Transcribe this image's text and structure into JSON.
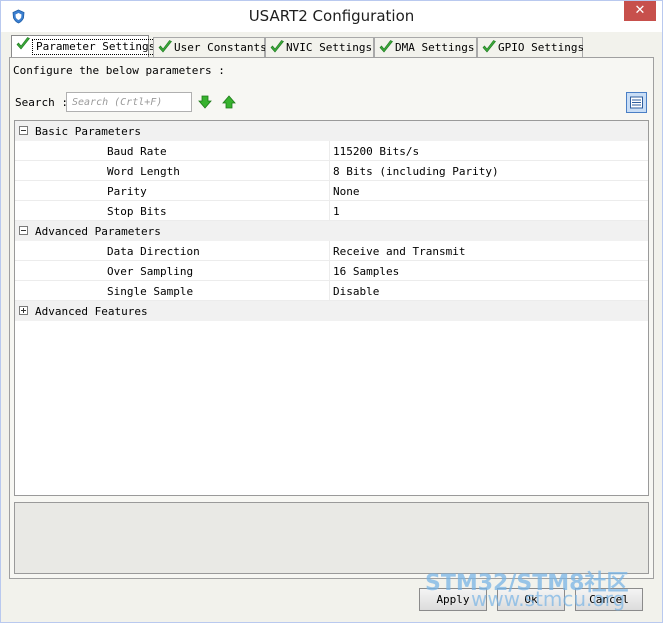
{
  "window": {
    "title": "USART2 Configuration",
    "close_glyph": "✕"
  },
  "tabs": [
    {
      "label": "Parameter Settings",
      "active": true
    },
    {
      "label": "User Constants"
    },
    {
      "label": "NVIC Settings"
    },
    {
      "label": "DMA Settings"
    },
    {
      "label": "GPIO Settings"
    }
  ],
  "panel": {
    "configure_text": "Configure the below parameters :",
    "search_label": "Search :",
    "search_placeholder": "Search (Crtl+F)"
  },
  "groups": [
    {
      "label": "Basic Parameters",
      "expanded": true,
      "params": [
        {
          "name": "Baud Rate",
          "value": "115200 Bits/s"
        },
        {
          "name": "Word Length",
          "value": "8 Bits (including Parity)"
        },
        {
          "name": "Parity",
          "value": "None"
        },
        {
          "name": "Stop Bits",
          "value": "1"
        }
      ]
    },
    {
      "label": "Advanced Parameters",
      "expanded": true,
      "params": [
        {
          "name": "Data Direction",
          "value": "Receive and Transmit"
        },
        {
          "name": "Over Sampling",
          "value": "16 Samples"
        },
        {
          "name": "Single Sample",
          "value": "Disable"
        }
      ]
    },
    {
      "label": "Advanced Features",
      "expanded": false,
      "params": []
    }
  ],
  "buttons": {
    "apply": "Apply",
    "ok": "Ok",
    "cancel": "Cancel"
  },
  "watermark": {
    "line1": "STM32/STM8社区",
    "line2": "www.stmcu.org"
  },
  "colors": {
    "check_green": "#3aa83a",
    "close_red": "#c7504c",
    "arrow_green": "#37b22e"
  },
  "icons": {
    "tab": "checkmark-icon",
    "down": "arrow-down-icon",
    "up": "arrow-up-icon",
    "list": "list-view-icon"
  }
}
